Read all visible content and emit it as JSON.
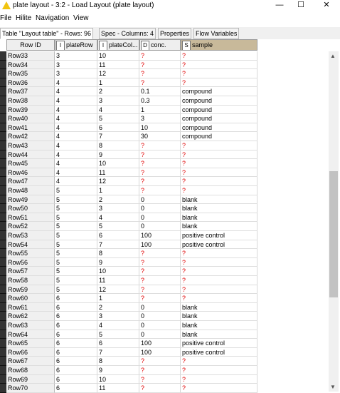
{
  "window": {
    "title": "plate layout - 3:2 - Load Layout (plate layout)",
    "minimize": "—",
    "maximize": "☐",
    "close": "✕"
  },
  "menu": [
    "File",
    "Hilite",
    "Navigation",
    "View"
  ],
  "tabs": [
    "Table \"Layout table\" - Rows: 96",
    "Spec - Columns: 4",
    "Properties",
    "Flow Variables"
  ],
  "columns": [
    {
      "label": "Row ID",
      "type": ""
    },
    {
      "label": "plateRow",
      "type": "I"
    },
    {
      "label": "plateCol...",
      "type": "I"
    },
    {
      "label": "conc.",
      "type": "D"
    },
    {
      "label": "sample",
      "type": "S"
    }
  ],
  "rows": [
    [
      "Row33",
      "3",
      "10",
      "?",
      "?"
    ],
    [
      "Row34",
      "3",
      "11",
      "?",
      "?"
    ],
    [
      "Row35",
      "3",
      "12",
      "?",
      "?"
    ],
    [
      "Row36",
      "4",
      "1",
      "?",
      "?"
    ],
    [
      "Row37",
      "4",
      "2",
      "0.1",
      "compound"
    ],
    [
      "Row38",
      "4",
      "3",
      "0.3",
      "compound"
    ],
    [
      "Row39",
      "4",
      "4",
      "1",
      "compound"
    ],
    [
      "Row40",
      "4",
      "5",
      "3",
      "compound"
    ],
    [
      "Row41",
      "4",
      "6",
      "10",
      "compound"
    ],
    [
      "Row42",
      "4",
      "7",
      "30",
      "compound"
    ],
    [
      "Row43",
      "4",
      "8",
      "?",
      "?"
    ],
    [
      "Row44",
      "4",
      "9",
      "?",
      "?"
    ],
    [
      "Row45",
      "4",
      "10",
      "?",
      "?"
    ],
    [
      "Row46",
      "4",
      "11",
      "?",
      "?"
    ],
    [
      "Row47",
      "4",
      "12",
      "?",
      "?"
    ],
    [
      "Row48",
      "5",
      "1",
      "?",
      "?"
    ],
    [
      "Row49",
      "5",
      "2",
      "0",
      "blank"
    ],
    [
      "Row50",
      "5",
      "3",
      "0",
      "blank"
    ],
    [
      "Row51",
      "5",
      "4",
      "0",
      "blank"
    ],
    [
      "Row52",
      "5",
      "5",
      "0",
      "blank"
    ],
    [
      "Row53",
      "5",
      "6",
      "100",
      "positive control"
    ],
    [
      "Row54",
      "5",
      "7",
      "100",
      "positive control"
    ],
    [
      "Row55",
      "5",
      "8",
      "?",
      "?"
    ],
    [
      "Row56",
      "5",
      "9",
      "?",
      "?"
    ],
    [
      "Row57",
      "5",
      "10",
      "?",
      "?"
    ],
    [
      "Row58",
      "5",
      "11",
      "?",
      "?"
    ],
    [
      "Row59",
      "5",
      "12",
      "?",
      "?"
    ],
    [
      "Row60",
      "6",
      "1",
      "?",
      "?"
    ],
    [
      "Row61",
      "6",
      "2",
      "0",
      "blank"
    ],
    [
      "Row62",
      "6",
      "3",
      "0",
      "blank"
    ],
    [
      "Row63",
      "6",
      "4",
      "0",
      "blank"
    ],
    [
      "Row64",
      "6",
      "5",
      "0",
      "blank"
    ],
    [
      "Row65",
      "6",
      "6",
      "100",
      "positive control"
    ],
    [
      "Row66",
      "6",
      "7",
      "100",
      "positive control"
    ],
    [
      "Row67",
      "6",
      "8",
      "?",
      "?"
    ],
    [
      "Row68",
      "6",
      "9",
      "?",
      "?"
    ],
    [
      "Row69",
      "6",
      "10",
      "?",
      "?"
    ],
    [
      "Row70",
      "6",
      "11",
      "?",
      "?"
    ]
  ],
  "scrollbar": {
    "up": "▲",
    "down": "▼",
    "position": 0.35
  },
  "colors": {
    "missing": "#e00000",
    "selected_header": "#c8b99a"
  }
}
